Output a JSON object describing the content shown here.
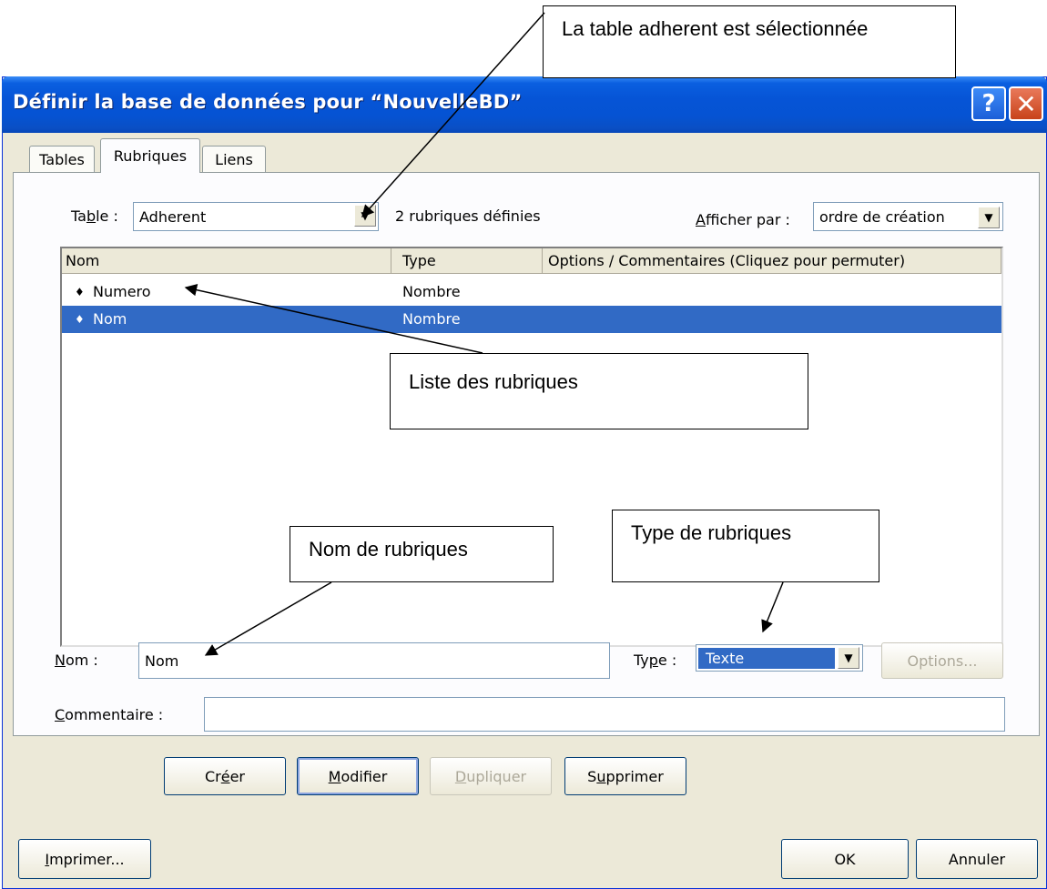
{
  "window": {
    "title": "Définir la base de données pour “NouvelleBD”",
    "help_glyph": "?",
    "close_glyph": "✕"
  },
  "tabs": [
    {
      "label": "Tables",
      "active": false
    },
    {
      "label": "Rubriques",
      "active": true
    },
    {
      "label": "Liens",
      "active": false
    }
  ],
  "table_select": {
    "label_pre": "Ta",
    "label_u": "b",
    "label_post": "le :",
    "value": "Adherent"
  },
  "field_count": "2 rubriques définies",
  "sort": {
    "label_u": "A",
    "label_post": "fficher par :",
    "value": "ordre de création"
  },
  "list": {
    "columns": [
      "Nom",
      "Type",
      "Options / Commentaires  (Cliquez pour permuter)"
    ],
    "rows": [
      {
        "bullet": "♦",
        "name": "Numero",
        "type": "Nombre",
        "selected": false
      },
      {
        "bullet": "♦",
        "name": "Nom",
        "type": "Nombre",
        "selected": true
      }
    ]
  },
  "name_field": {
    "label_u": "N",
    "label_post": "om :",
    "value": "Nom"
  },
  "type_field": {
    "label_pre": "Ty",
    "label_u": "p",
    "label_post": "e :",
    "value": "Texte"
  },
  "options_button": "Options...",
  "comment_field": {
    "label_u": "C",
    "label_post": "ommentaire :",
    "value": ""
  },
  "buttons": {
    "create": {
      "pre": "Cr",
      "u": "é",
      "post": "er"
    },
    "modify": {
      "pre": "",
      "u": "M",
      "post": "odifier"
    },
    "duplicate": {
      "pre": "",
      "u": "D",
      "post": "upliquer"
    },
    "delete": {
      "pre": "S",
      "u": "u",
      "post": "pprimer"
    },
    "print": {
      "pre": "",
      "u": "I",
      "post": "mprimer..."
    },
    "ok": "OK",
    "cancel": "Annuler"
  },
  "callouts": {
    "table_selected": "La table adherent est sélectionnée",
    "field_list": "Liste des rubriques",
    "field_name": "Nom de  rubriques",
    "field_type": "Type de  rubriques"
  },
  "colors": {
    "titlebar": "#0654d6",
    "selection": "#316ac5",
    "dialog_bg": "#ece9d8"
  }
}
